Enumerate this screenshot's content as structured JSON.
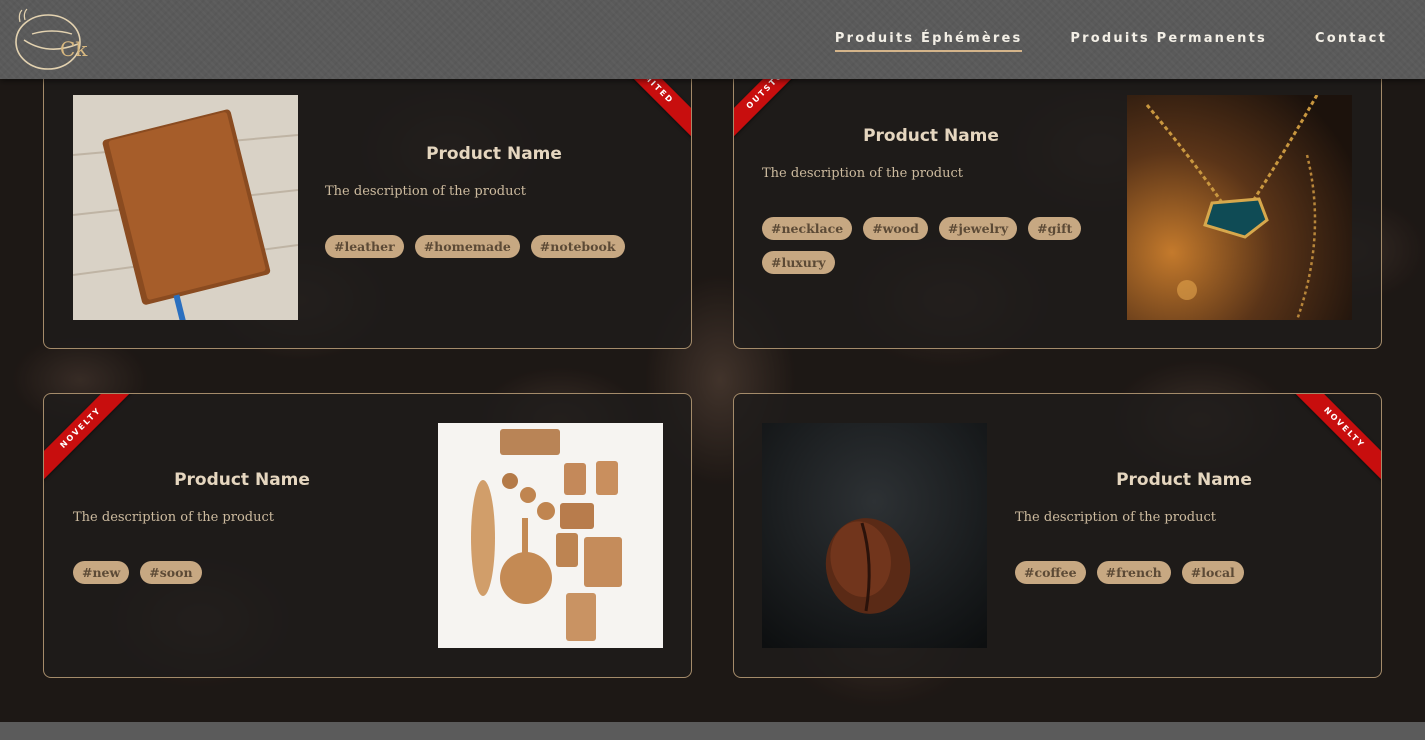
{
  "header": {
    "logo_text": "Ck",
    "nav": [
      {
        "label": "Produits Éphémères",
        "active": true
      },
      {
        "label": "Produits Permanents",
        "active": false
      },
      {
        "label": "Contact",
        "active": false
      }
    ]
  },
  "colors": {
    "accent": "#d4b48a",
    "tag_bg": "#c7a882",
    "ribbon": "#c80e0e",
    "card_border": "#a48b6a"
  },
  "products": [
    {
      "name": "Product Name",
      "description": "The description of the product",
      "tags": [
        "#leather",
        "#homemade",
        "#notebook"
      ],
      "ribbon": "LIMITED",
      "image": "leather-notebook"
    },
    {
      "name": "Product Name",
      "description": "The description of the product",
      "tags": [
        "#necklace",
        "#wood",
        "#jewelry",
        "#gift",
        "#luxury"
      ],
      "ribbon": "OUTSTOCK",
      "image": "emerald-necklace"
    },
    {
      "name": "Product Name",
      "description": "The description of the product",
      "tags": [
        "#new",
        "#soon"
      ],
      "ribbon": "NOVELTY",
      "image": "wooden-kitchenware"
    },
    {
      "name": "Product Name",
      "description": "The description of the product",
      "tags": [
        "#coffee",
        "#french",
        "#local"
      ],
      "ribbon": "NOVELTY",
      "image": "coffee-bean"
    }
  ]
}
